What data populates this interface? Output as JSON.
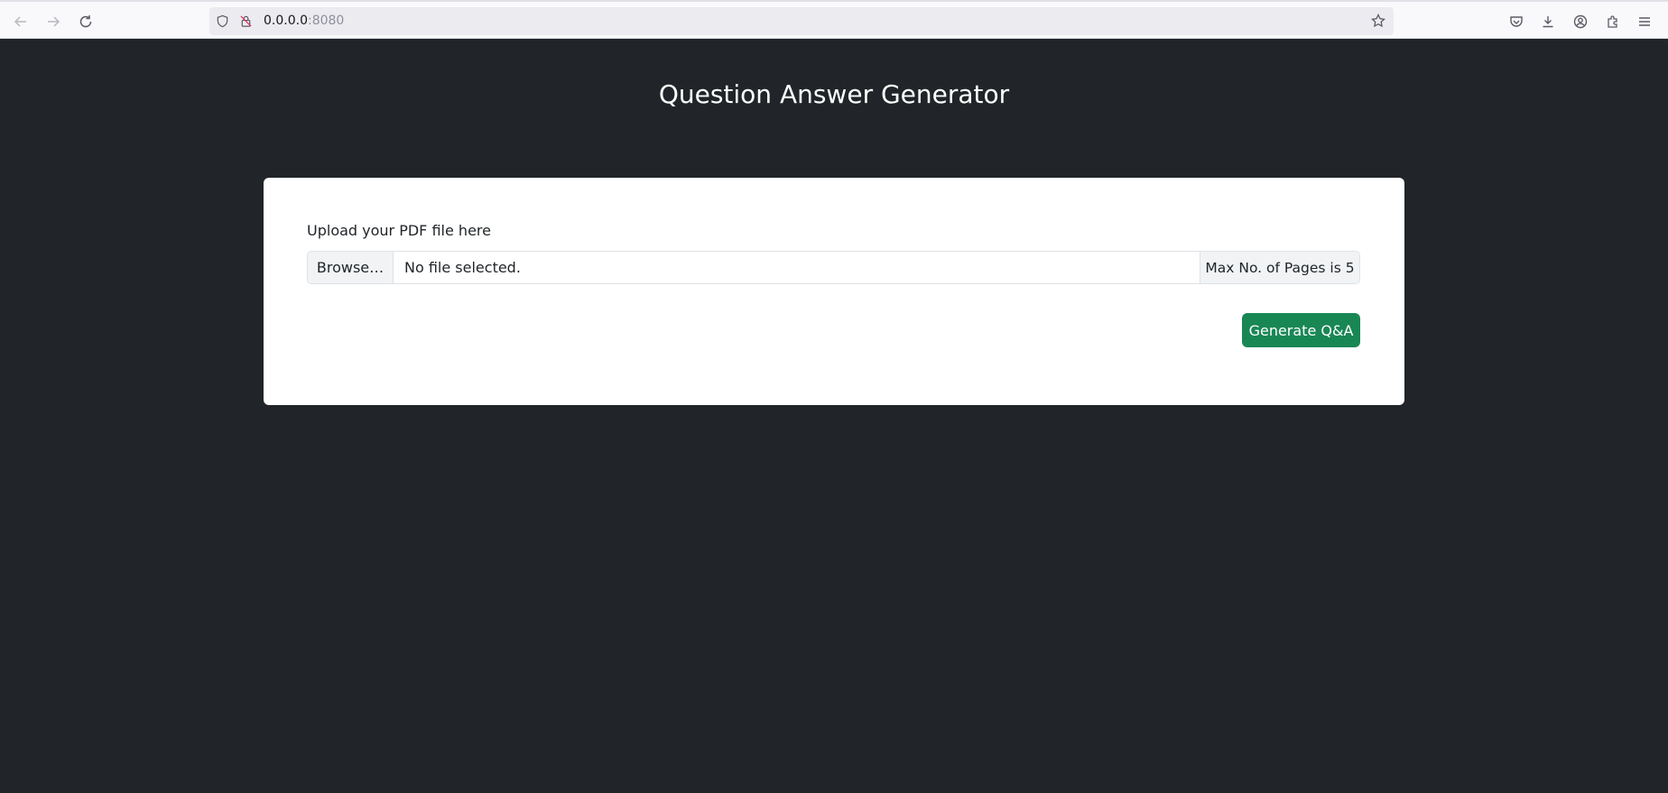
{
  "browser": {
    "url_host": "0.0.0.0",
    "url_port": ":8080"
  },
  "page": {
    "title": "Question Answer Generator"
  },
  "form": {
    "upload_label": "Upload your PDF file here",
    "browse_label": "Browse…",
    "file_status": "No file selected.",
    "max_pages_note": "Max No. of Pages is 5",
    "submit_label": "Generate Q&A"
  },
  "colors": {
    "background": "#212529",
    "card": "#ffffff",
    "button": "#198754"
  }
}
